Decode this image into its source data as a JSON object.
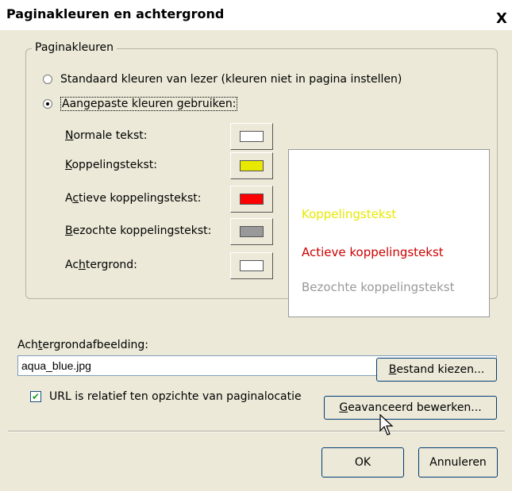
{
  "dialog": {
    "title": "Paginakleuren en achtergrond",
    "close_label": "X"
  },
  "page_colors": {
    "group_label": "Paginakleuren",
    "radio_default": "Standaard kleuren van lezer (kleuren niet in pagina instellen)",
    "radio_custom": "Aangepaste kleuren gebruiken:",
    "rows": [
      {
        "label": "Normale tekst:",
        "underline_index": 0,
        "color": "#ffffff"
      },
      {
        "label": "Koppelingstekst:",
        "underline_index": 0,
        "color": "#e8e800"
      },
      {
        "label": "Actieve koppelingstekst:",
        "underline_index": 1,
        "color": "#ff0000"
      },
      {
        "label": "Bezochte koppelingstekst:",
        "underline_index": 0,
        "color": "#999999"
      },
      {
        "label": "Achtergrond:",
        "underline_index": 2,
        "color": "#ffffff"
      }
    ]
  },
  "preview": {
    "link_text": "Koppelingstekst",
    "active_text": "Actieve koppelingstekst",
    "visited_text": "Bezochte koppelingstekst",
    "link_color": "#e8e800",
    "active_color": "#cc0000",
    "visited_color": "#999999"
  },
  "background_image": {
    "label": "Achtergrondafbeelding:",
    "value": "aqua_blue.jpg",
    "relative_checkbox_label": "URL is relatief ten opzichte van paginalocatie",
    "relative_checked": true,
    "choose_file_button": "Bestand kiezen...",
    "advanced_edit_button": "Geavanceerd bewerken..."
  },
  "buttons": {
    "ok": "OK",
    "cancel": "Annuleren"
  }
}
